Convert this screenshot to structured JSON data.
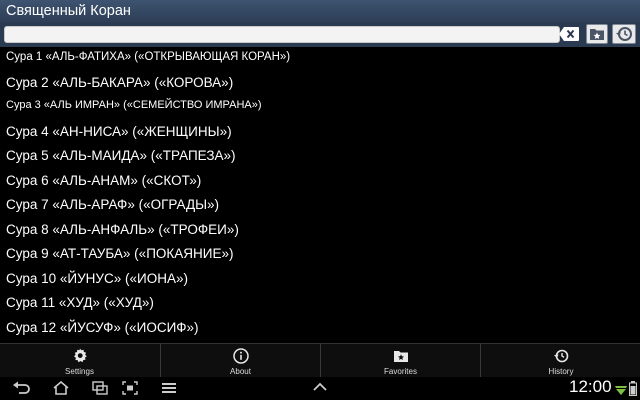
{
  "app": {
    "title": "Священный Коран"
  },
  "search": {
    "value": "",
    "placeholder": ""
  },
  "suras": [
    "Сура 1 «АЛЬ-ФАТИХА» («ОТКРЫВАЮЩАЯ КОРАН»)",
    "Сура 2 «АЛЬ-БАКАРА» («КОРОВА»)",
    "Сура 3 «АЛЬ ИМРАН» («СЕМЕЙСТВО ИМРАНА»)",
    "Сура 4 «АН-НИСА» («ЖЕНЩИНЫ»)",
    "Сура 5 «АЛЬ-МАИДА» («ТРАПЕЗА»)",
    "Сура 6 «АЛЬ-АНАМ» («СКОТ»)",
    "Сура 7 «АЛЬ-АРАФ» («ОГРАДЫ»)",
    "Сура 8 «АЛЬ-АНФАЛЬ» («ТРОФЕИ»)",
    "Сура 9 «АТ-ТАУБА» («ПОКАЯНИЕ»)",
    "Сура 10 «ЙУНУС» («ИОНА»)",
    "Сура 11 «ХУД» («ХУД»)",
    "Сура 12 «ЙУСУФ» («ИОСИФ»)"
  ],
  "nav": [
    {
      "label": "Settings",
      "icon": "gear-icon"
    },
    {
      "label": "About",
      "icon": "info-icon"
    },
    {
      "label": "Favorites",
      "icon": "folder-star-icon"
    },
    {
      "label": "History",
      "icon": "history-icon"
    }
  ],
  "status": {
    "time": "12:00"
  },
  "colors": {
    "titlebar": "#34485f",
    "background": "#000000",
    "text": "#ffffff"
  }
}
